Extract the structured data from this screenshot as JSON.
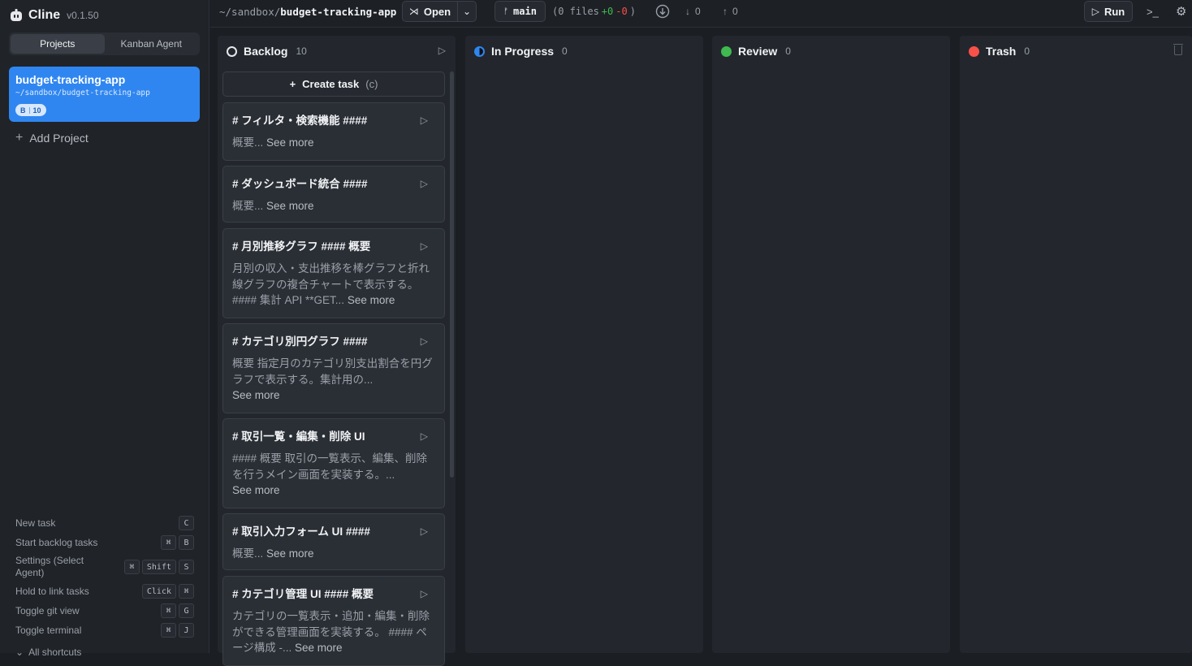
{
  "app": {
    "name": "Cline",
    "version": "v0.1.50"
  },
  "sidebar": {
    "tabs": [
      {
        "label": "Projects",
        "active": true
      },
      {
        "label": "Kanban Agent",
        "active": false
      }
    ],
    "project": {
      "name": "budget-tracking-app",
      "path": "~/sandbox/budget-tracking-app",
      "badge_letter": "B",
      "badge_count": "10"
    },
    "add_project": "Add Project",
    "shortcuts": [
      {
        "label": "New task",
        "keys": [
          "C"
        ]
      },
      {
        "label": "Start backlog tasks",
        "keys": [
          "⌘",
          "B"
        ]
      },
      {
        "label": "Settings (Select Agent)",
        "keys": [
          "⌘",
          "Shift",
          "S"
        ]
      },
      {
        "label": "Hold to link tasks",
        "keys": [
          "Click",
          "⌘"
        ]
      },
      {
        "label": "Toggle git view",
        "keys": [
          "⌘",
          "G"
        ]
      },
      {
        "label": "Toggle terminal",
        "keys": [
          "⌘",
          "J"
        ]
      }
    ],
    "all_shortcuts": "All shortcuts"
  },
  "topbar": {
    "path_prefix": "~/sandbox/",
    "path_name": "budget-tracking-app",
    "open_label": "Open",
    "branch": "main",
    "files_text": "(0 files",
    "added": "+0",
    "removed": "-0",
    "files_close": ")",
    "pull_count": "0",
    "push_count": "0",
    "run_label": "Run"
  },
  "columns": {
    "backlog": {
      "title": "Backlog",
      "count": "10",
      "create_label": "Create task",
      "create_shortcut": "(c)"
    },
    "in_progress": {
      "title": "In Progress",
      "count": "0"
    },
    "review": {
      "title": "Review",
      "count": "0"
    },
    "trash": {
      "title": "Trash",
      "count": "0"
    }
  },
  "cards": [
    {
      "title": "# フィルタ・検索機能 ####",
      "desc": "概要...",
      "more": "See more"
    },
    {
      "title": "# ダッシュボード統合 ####",
      "desc": "概要...",
      "more": "See more"
    },
    {
      "title": "# 月別推移グラフ #### 概要",
      "desc": "月別の収入・支出推移を棒グラフと折れ線グラフの複合チャートで表示する。 #### 集計 API **GET...",
      "more": "See more"
    },
    {
      "title": "# カテゴリ別円グラフ ####",
      "desc": "概要 指定月のカテゴリ別支出割合を円グラフで表示する。集計用の...",
      "more": "See more"
    },
    {
      "title": "# 取引一覧・編集・削除 UI",
      "desc": "#### 概要 取引の一覧表示、編集、削除を行うメイン画面を実装する。...",
      "more": "See more"
    },
    {
      "title": "# 取引入力フォーム UI ####",
      "desc": "概要...",
      "more": "See more"
    },
    {
      "title": "# カテゴリ管理 UI #### 概要",
      "desc": "カテゴリの一覧表示・追加・編集・削除ができる管理画面を実装する。 #### ページ構成 -...",
      "more": "See more"
    }
  ]
}
